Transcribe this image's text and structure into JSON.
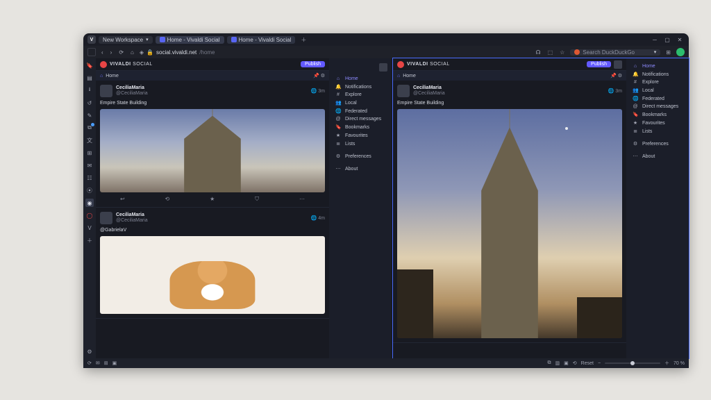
{
  "workspace_label": "New Workspace",
  "tabs": [
    {
      "label": "Home - Vivaldi Social",
      "active": true
    },
    {
      "label": "Home - Vivaldi Social",
      "active": false
    }
  ],
  "url_host": "social.vivaldi.net",
  "url_path": "/home",
  "search_placeholder": "Search DuckDuckGo",
  "brand_line1": "VIVALDI",
  "brand_line2": "SOCIAL",
  "publish_label": "Publish",
  "col_header": "Home",
  "nav": {
    "home": "Home",
    "notifications": "Notifications",
    "explore": "Explore",
    "local": "Local",
    "federated": "Federated",
    "dm": "Direct messages",
    "bookmarks": "Bookmarks",
    "favourites": "Favourites",
    "lists": "Lists",
    "preferences": "Preferences",
    "about": "About"
  },
  "posts_left": [
    {
      "display": "CeciliaMaria",
      "handle": "@CeciliaMaria",
      "time": "3m",
      "body": "Empire State Building",
      "media": "empire-small"
    },
    {
      "display": "CeciliaMaria",
      "handle": "@CeciliaMaria",
      "time": "4m",
      "body": "@GabrielaV",
      "media": "corgi"
    }
  ],
  "posts_right": [
    {
      "display": "CeciliaMaria",
      "handle": "@CeciliaMaria",
      "time": "3m",
      "body": "Empire State Building",
      "media": "empire-large"
    }
  ],
  "status": {
    "reset": "Reset",
    "zoom": "70 %"
  }
}
